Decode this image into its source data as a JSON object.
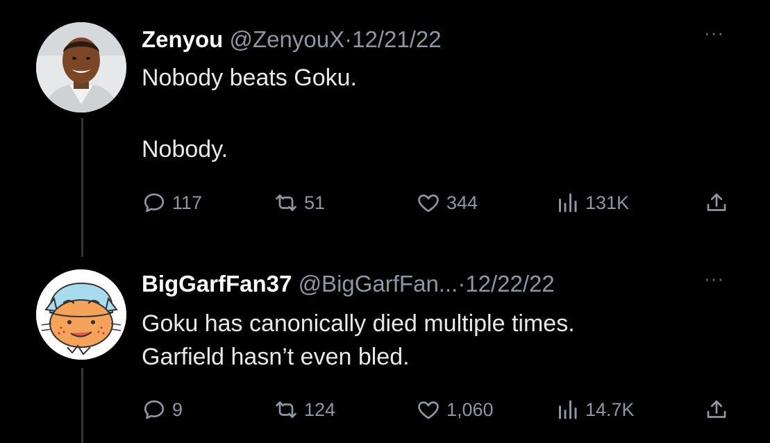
{
  "tweets": [
    {
      "author_name": "Zenyou",
      "author_handle": "@ZenyouX",
      "separator": "·",
      "date": "12/21/22",
      "more_label": "···",
      "paragraphs": [
        "Nobody beats Goku.",
        "Nobody."
      ],
      "stats": {
        "replies": "117",
        "retweets": "51",
        "likes": "344",
        "views": "131K"
      },
      "avatar_icon": "person-photo-avatar"
    },
    {
      "author_name": "BigGarfFan37",
      "author_handle": "@BigGarfFan...",
      "separator": "·",
      "date": "12/22/22",
      "more_label": "···",
      "paragraphs": [
        "Goku has canonically died multiple times.",
        "Garfield hasn’t even bled."
      ],
      "stats": {
        "replies": "9",
        "retweets": "124",
        "likes": "1,060",
        "views": "14.7K"
      },
      "avatar_icon": "cartoon-cat-avatar"
    }
  ],
  "icons": {
    "reply": "speech-bubble-icon",
    "retweet": "retweet-arrows-icon",
    "like": "heart-icon",
    "views": "bar-chart-icon",
    "share": "share-upload-icon"
  },
  "colors": {
    "background": "#000000",
    "text": "#e7e9ea",
    "secondary": "#8b98a5",
    "thread_line": "#333639"
  }
}
